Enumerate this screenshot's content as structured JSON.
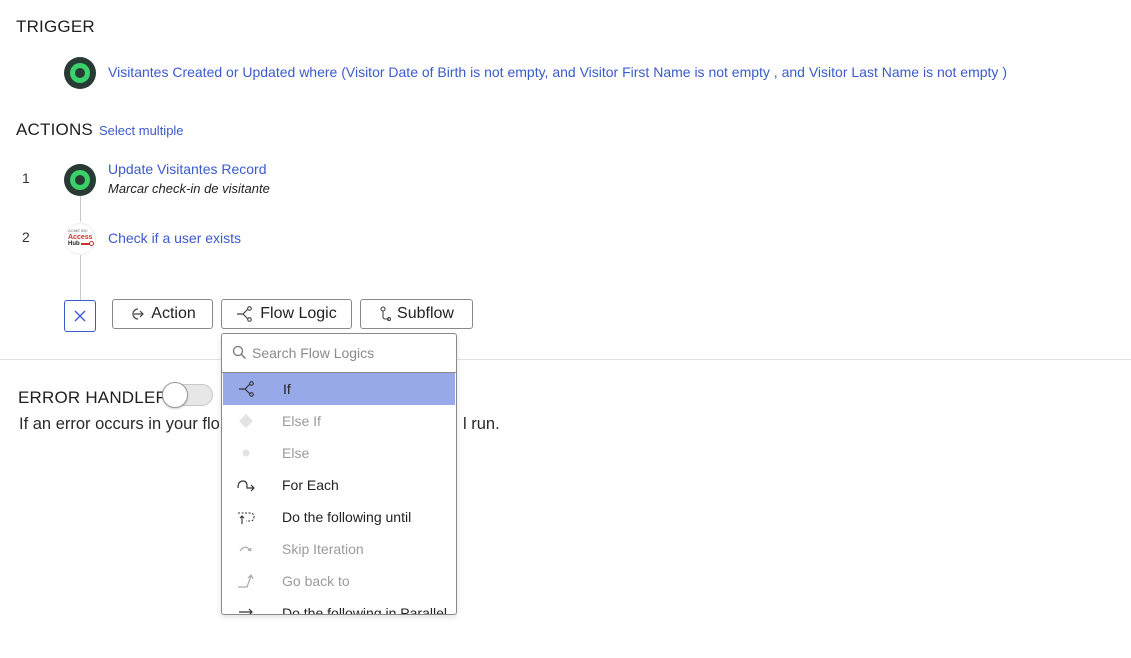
{
  "trigger": {
    "title": "TRIGGER",
    "text": "Visitantes Created or Updated where (Visitor Date of Birth is not empty, and Visitor First Name is not empty , and Visitor Last Name is not empty )"
  },
  "actions": {
    "title": "ACTIONS",
    "select_multiple": "Select multiple",
    "steps": [
      {
        "number": "1",
        "title": "Update Visitantes Record",
        "subtitle": "Marcar check-in de visitante",
        "icon": "spoke-icon"
      },
      {
        "number": "2",
        "title": "Check if a user exists",
        "icon": "access-hub-logo",
        "logo_lines": [
          "ACME INC",
          "Access",
          "Hub"
        ]
      }
    ]
  },
  "add_toolbar": {
    "action_label": "Action",
    "flow_logic_label": "Flow Logic",
    "subflow_label": "Subflow"
  },
  "flow_logic_menu": {
    "search_placeholder": "Search Flow Logics",
    "items": [
      {
        "label": "If",
        "icon": "if-icon",
        "state": "selected"
      },
      {
        "label": "Else If",
        "icon": "diamond-icon",
        "state": "disabled"
      },
      {
        "label": "Else",
        "icon": "dot-icon",
        "state": "disabled"
      },
      {
        "label": "For Each",
        "icon": "for-each-icon",
        "state": "enabled"
      },
      {
        "label": "Do the following until",
        "icon": "loop-until-icon",
        "state": "enabled"
      },
      {
        "label": "Skip Iteration",
        "icon": "skip-icon",
        "state": "disabled"
      },
      {
        "label": "Go back to",
        "icon": "go-back-icon",
        "state": "disabled"
      },
      {
        "label": "Do the following in Parallel",
        "icon": "parallel-icon",
        "state": "enabled"
      }
    ]
  },
  "error_handler": {
    "title": "ERROR HANDLER",
    "toggle_on": false,
    "description_start": "If an error occurs in your flo",
    "description_end": "l run."
  },
  "colors": {
    "link": "#3b5bcc",
    "selected_item": "#97a9e8",
    "trigger_icon_ring": "#3ad06a"
  }
}
